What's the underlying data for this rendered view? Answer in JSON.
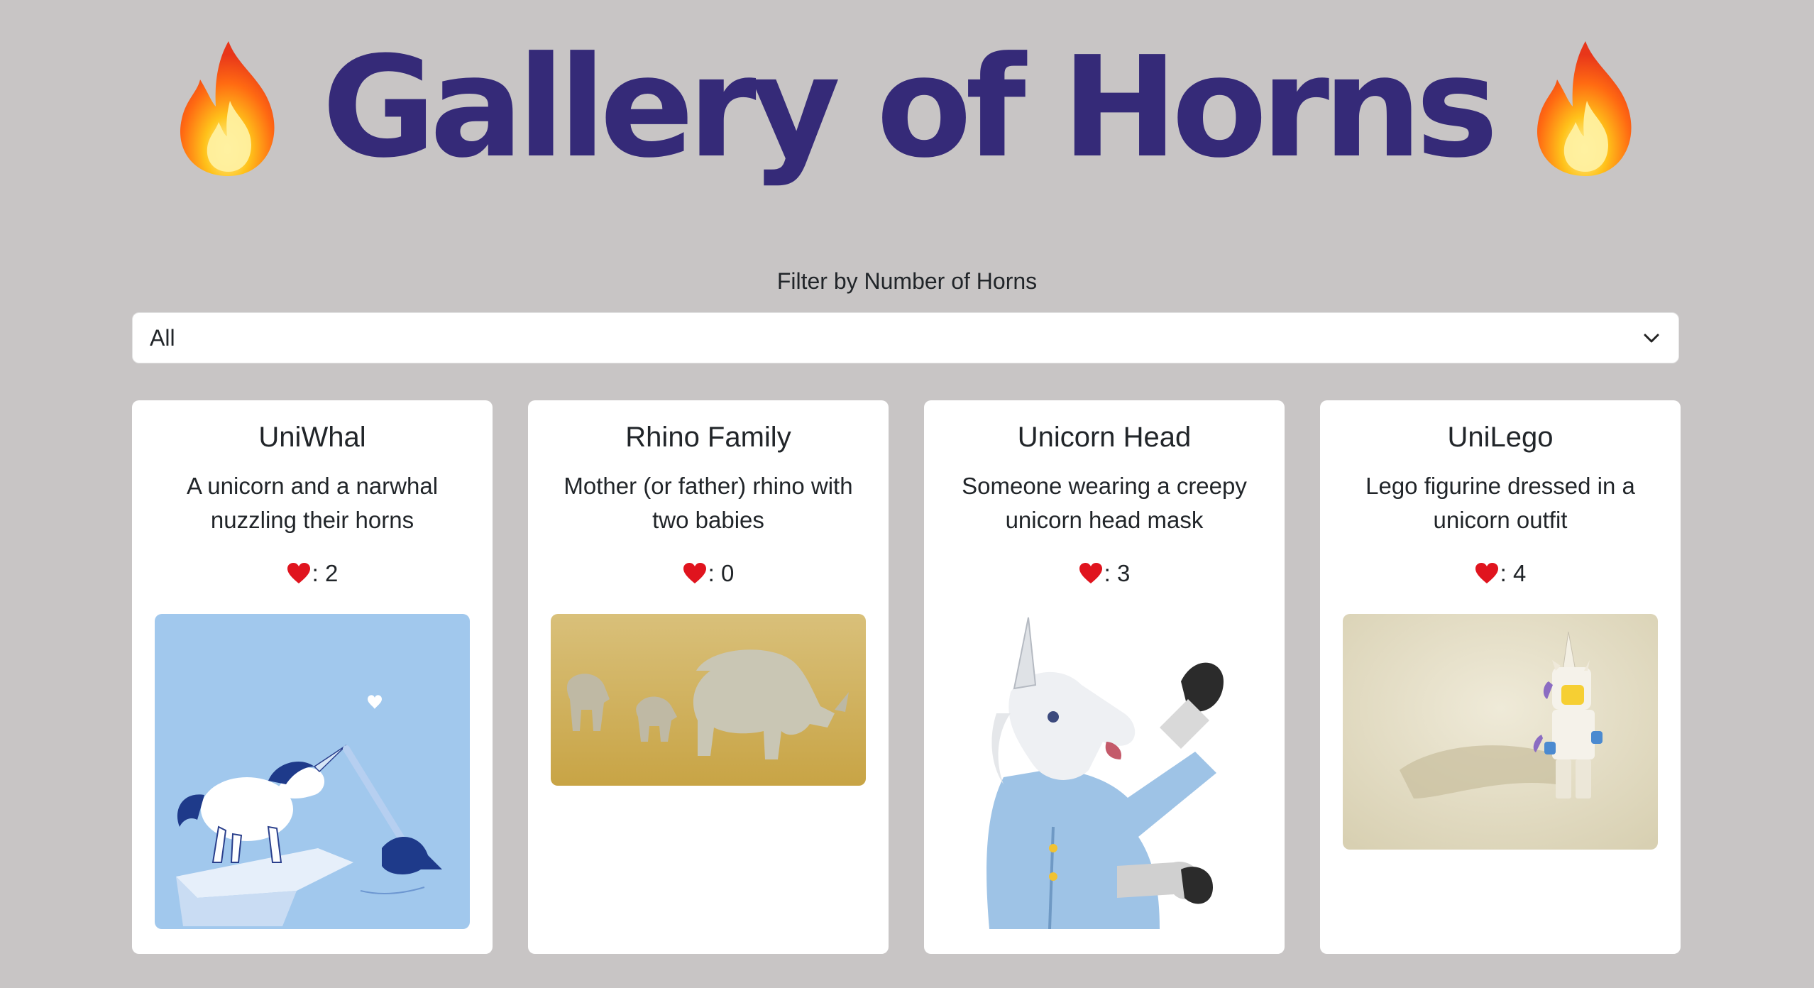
{
  "page": {
    "title": "Gallery of Horns",
    "title_icon": "fire-emoji",
    "title_color": "#352a78",
    "background_color": "#c8c5c5"
  },
  "filter": {
    "label": "Filter by Number of Horns",
    "selected": "All"
  },
  "cards": [
    {
      "title": "UniWhal",
      "description": "A unicorn and a narwhal nuzzling their horns",
      "likes_icon": "heart-emoji",
      "likes": ": 2",
      "image": "unicorn-narwhal-illustration"
    },
    {
      "title": "Rhino Family",
      "description": "Mother (or father) rhino with two babies",
      "likes_icon": "heart-emoji",
      "likes": ": 0",
      "image": "rhino-family-photo"
    },
    {
      "title": "Unicorn Head",
      "description": "Someone wearing a creepy unicorn head mask",
      "likes_icon": "heart-emoji",
      "likes": ": 3",
      "image": "unicorn-mask-photo"
    },
    {
      "title": "UniLego",
      "description": "Lego figurine dressed in a unicorn outfit",
      "likes_icon": "heart-emoji",
      "likes": ": 4",
      "image": "lego-unicorn-photo"
    }
  ]
}
